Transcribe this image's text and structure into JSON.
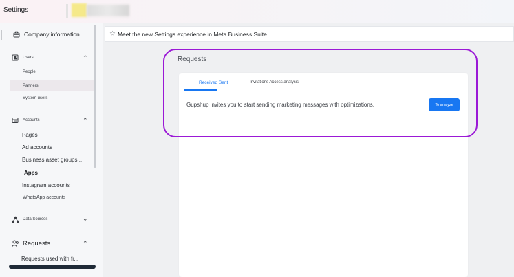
{
  "topbar": {
    "title": "Settings"
  },
  "sidebar": {
    "company_info": "Company information",
    "users": {
      "label": "Users",
      "items": [
        "People",
        "Partners",
        "System users"
      ]
    },
    "accounts": {
      "label": "Accounts",
      "items": [
        "Pages",
        "Ad accounts",
        "Business asset groups...",
        "Apps",
        "Instagram accounts",
        "WhatsApp accounts"
      ]
    },
    "data_sources": "Data Sources",
    "requests": {
      "label": "Requests",
      "items": [
        "Requests used with fr..."
      ]
    }
  },
  "main": {
    "banner": "Meet the new Settings experience in Meta Business Suite",
    "section_title": "Requests",
    "tabs": {
      "received": "Received Sent",
      "other": "Invitations Access analysis"
    },
    "message": "Gupshup invites you to start sending marketing messages with optimizations.",
    "analyze_button": "To analyze"
  },
  "colors": {
    "accent": "#1877f2",
    "highlight": "#9b19d6",
    "sidebar_bg": "#f6f7f9",
    "main_bg": "#eff0f2"
  },
  "icons": {
    "company": "briefcase-icon",
    "users": "user-badge-icon",
    "accounts": "accounts-icon",
    "data_sources": "data-sources-icon",
    "requests": "people-icon",
    "banner": "star-icon"
  }
}
